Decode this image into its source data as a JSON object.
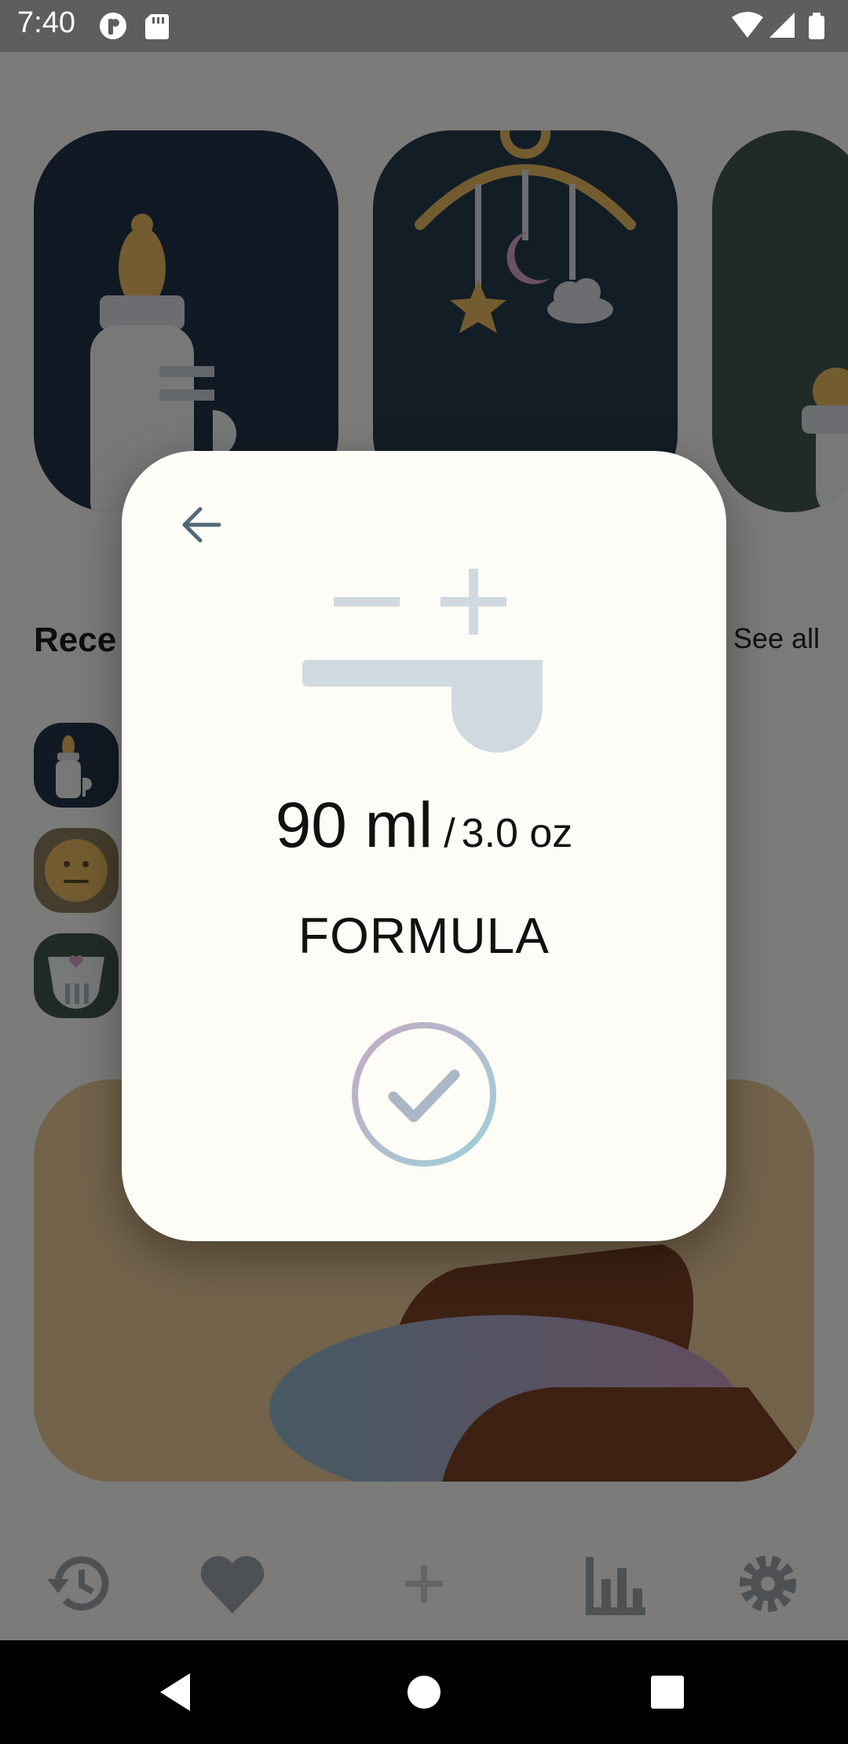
{
  "status_bar": {
    "time": "7:40",
    "icons_left": [
      "app-notification-icon",
      "sd-card-icon"
    ],
    "icons_right": [
      "wifi-icon",
      "signal-icon",
      "battery-icon"
    ]
  },
  "home": {
    "recent_title": "Rece",
    "see_all_label": "See all",
    "categories": [
      {
        "icon": "baby-bottle-icon",
        "color": "#233549"
      },
      {
        "icon": "crib-mobile-icon",
        "color": "#263a4c"
      },
      {
        "icon": "diaper-icon",
        "color": "#40574f"
      }
    ],
    "recent_items": [
      {
        "icon": "baby-bottle-icon"
      },
      {
        "icon": "neutral-face-icon"
      },
      {
        "icon": "diaper-icon"
      }
    ]
  },
  "bottom_nav": {
    "items": [
      {
        "icon": "history-icon"
      },
      {
        "icon": "heart-icon"
      },
      {
        "icon": "plus-icon"
      },
      {
        "icon": "bar-chart-icon"
      },
      {
        "icon": "gear-icon"
      }
    ]
  },
  "dialog": {
    "amount_main": "90 ml",
    "amount_separator": "/",
    "amount_sub": "3.0 oz",
    "feed_type": "FORMULA",
    "icons": [
      "back-arrow-icon",
      "minus-icon",
      "plus-icon",
      "scoop-icon",
      "check-icon"
    ]
  },
  "colors": {
    "scrim": "rgba(0,0,0,0.5)",
    "dialog_bg": "#fdfcf6",
    "scoop": "#cfd9df",
    "check_gradient_start": "#c5a9c4",
    "check_gradient_end": "#9fd0d8"
  }
}
